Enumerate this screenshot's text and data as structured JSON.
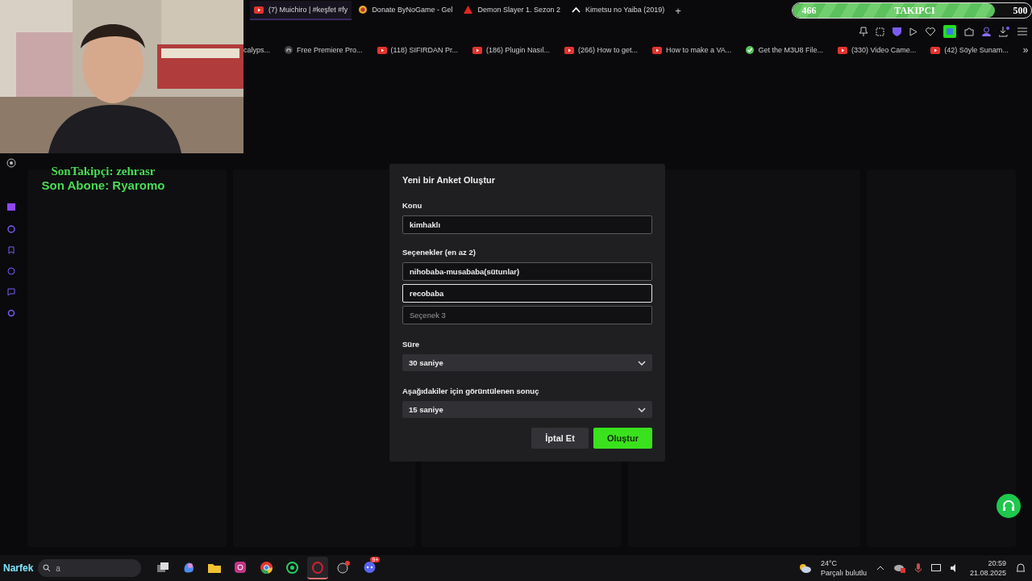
{
  "follower_goal": {
    "current": "466",
    "label": "TAKIPCI",
    "target": "500",
    "level": 0.85
  },
  "tabs": [
    {
      "title": "(7) Muichiro | #keşfet #fy",
      "kind": "video",
      "selected": true
    },
    {
      "title": "Donate ByNoGame - Gel",
      "kind": "coin",
      "selected": false
    },
    {
      "title": "Demon Slayer 1. Sezon 2",
      "kind": "triangle",
      "selected": false
    },
    {
      "title": "Kimetsu no Yaiba (2019)",
      "kind": "chevron",
      "selected": false
    }
  ],
  "new_tab_button": "+",
  "more_bookmarks_button": "»",
  "bookmarks": [
    {
      "title": "calyps...",
      "kind": "none"
    },
    {
      "title": "Free Premiere Pro...",
      "kind": "letter"
    },
    {
      "title": "(118) SIFIRDAN Pr...",
      "kind": "video"
    },
    {
      "title": "(186) Plugin Nasıl...",
      "kind": "video"
    },
    {
      "title": "(266) How to get...",
      "kind": "video"
    },
    {
      "title": "How to make a VA...",
      "kind": "video"
    },
    {
      "title": "Get the M3U8 File...",
      "kind": "check"
    },
    {
      "title": "(330) Video Came...",
      "kind": "video"
    },
    {
      "title": "(42) Söyle Sunam...",
      "kind": "video"
    }
  ],
  "overlay": {
    "last_follower": "SonTakipçi: zehrasr",
    "last_subscriber": "Son Abone: Ryaromo"
  },
  "dialog": {
    "title": "Yeni bir Anket Oluştur",
    "topic": {
      "label": "Konu",
      "value": "kimhaklı"
    },
    "options_label": "Seçenekler (en az 2)",
    "options": [
      {
        "value": "nihobaba-musababa(sütunlar)",
        "focused": false
      },
      {
        "value": "recobaba",
        "focused": true
      },
      {
        "placeholder": "Seçenek 3",
        "focused": false
      }
    ],
    "duration": {
      "label": "Süre",
      "value": "30 saniye"
    },
    "result": {
      "label": "Aşağıdakiler için görüntülenen sonuç",
      "value": "15 saniye"
    },
    "cancel": "İptal Et",
    "submit": "Oluştur"
  },
  "taskbar": {
    "start_label": "Narfek",
    "search_placeholder": "a",
    "apps": [
      {
        "kind": "taskview",
        "selected": false
      },
      {
        "kind": "copilot",
        "selected": false
      },
      {
        "kind": "folder",
        "selected": false
      },
      {
        "kind": "camera",
        "selected": false
      },
      {
        "kind": "chrome",
        "selected": false
      },
      {
        "kind": "whatsapp",
        "selected": false
      },
      {
        "kind": "opera",
        "selected": true
      },
      {
        "kind": "obs",
        "selected": false
      },
      {
        "kind": "discord",
        "selected": false,
        "badge": "9+"
      }
    ],
    "weather": {
      "temperature": "24°C",
      "condition": "Parçalı bulutlu"
    },
    "time": "20:59",
    "date": "21.08.2025"
  }
}
